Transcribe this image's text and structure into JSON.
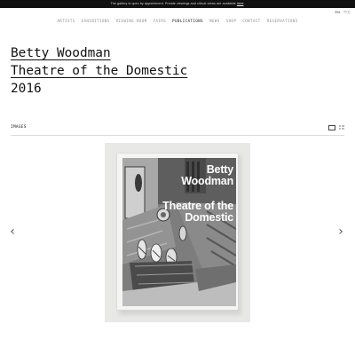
{
  "topbar": {
    "notice": "The gallery is open by appointment. Private viewings and virtual views are available",
    "link": "here",
    "end": "."
  },
  "language": {
    "current": "EN",
    "other": "中文"
  },
  "nav": {
    "items": [
      {
        "label": "ARTISTS"
      },
      {
        "label": "EXHIBITIONS"
      },
      {
        "label": "VIEWING ROOM"
      },
      {
        "label": "FAIRS"
      },
      {
        "label": "PUBLICATIONS"
      },
      {
        "label": "NEWS"
      },
      {
        "label": "SHOP"
      },
      {
        "label": "CONTACT"
      },
      {
        "label": "RESERVATIONS"
      }
    ],
    "active": "PUBLICATIONS"
  },
  "publication": {
    "line1": "Betty Woodman",
    "line2": "Theatre of the Domestic",
    "line3": "2016"
  },
  "images_section": {
    "label": "IMAGES"
  },
  "book_cover": {
    "author_line1": "Betty",
    "author_line2": "Woodman",
    "title_line1": "Theatre of the",
    "title_line2": "Domestic"
  },
  "controls": {
    "prev_glyph": "‹",
    "next_glyph": "›"
  },
  "colors": {
    "topbar_bg": "#111111",
    "nav_inactive": "#8c8c8c",
    "nav_active": "#111111",
    "gallery_bg": "#e8e8e6"
  }
}
